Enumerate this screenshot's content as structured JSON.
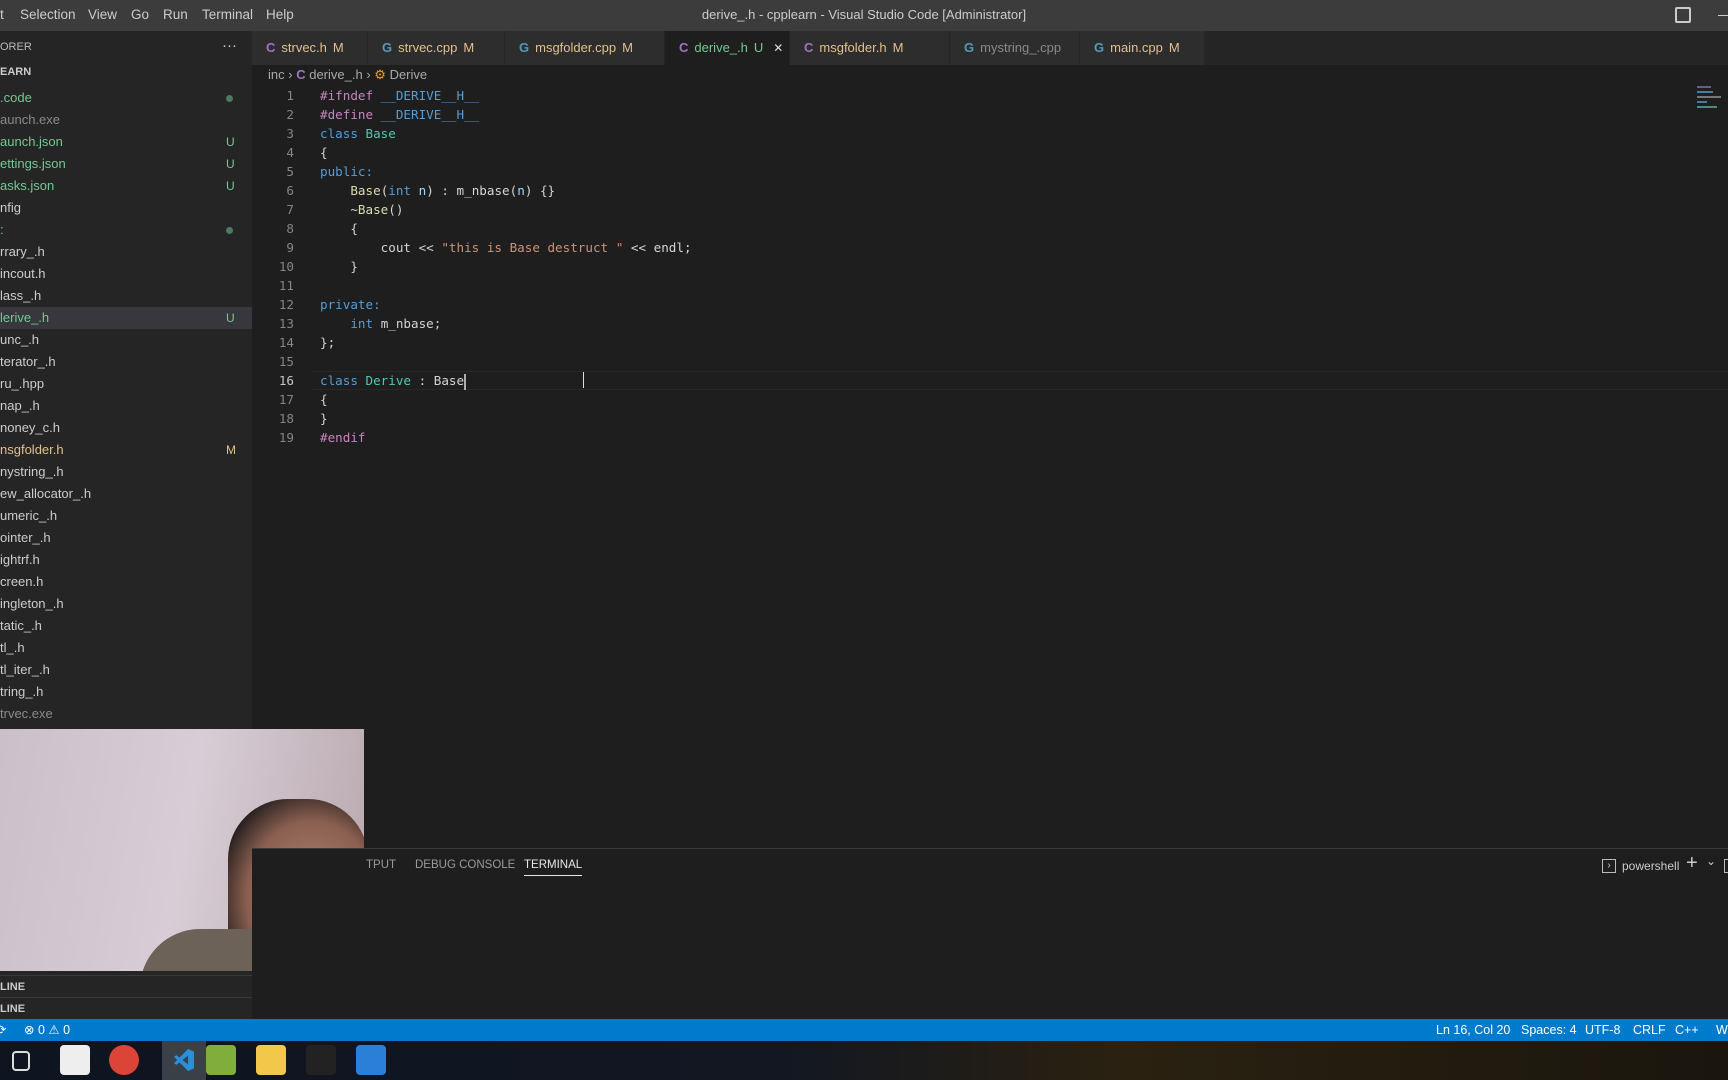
{
  "window": {
    "title": "derive_.h - cpplearn - Visual Studio Code [Administrator]"
  },
  "menu": [
    "t",
    "Selection",
    "View",
    "Go",
    "Run",
    "Terminal",
    "Help"
  ],
  "sidebar": {
    "header": "ORER",
    "more": "···",
    "root": "EARN",
    "items": [
      {
        "label": ".code",
        "c": "g",
        "dot": true
      },
      {
        "label": "aunch.exe",
        "c": "d"
      },
      {
        "label": "aunch.json",
        "c": "g",
        "badge": "U"
      },
      {
        "label": "ettings.json",
        "c": "g",
        "badge": "U"
      },
      {
        "label": "asks.json",
        "c": "g",
        "badge": "U"
      },
      {
        "label": "nfig",
        "c": "n"
      },
      {
        "label": ":",
        "c": "g",
        "dot": true
      },
      {
        "label": "rrary_.h",
        "c": "n"
      },
      {
        "label": "incout.h",
        "c": "n"
      },
      {
        "label": "lass_.h",
        "c": "n"
      },
      {
        "label": "lerive_.h",
        "c": "g",
        "badge": "U",
        "selected": true
      },
      {
        "label": "unc_.h",
        "c": "n"
      },
      {
        "label": "terator_.h",
        "c": "n"
      },
      {
        "label": "ru_.hpp",
        "c": "n"
      },
      {
        "label": "nap_.h",
        "c": "n"
      },
      {
        "label": "noney_c.h",
        "c": "n"
      },
      {
        "label": "nsgfolder.h",
        "c": "m",
        "badge": "M"
      },
      {
        "label": "nystring_.h",
        "c": "n"
      },
      {
        "label": "ew_allocator_.h",
        "c": "n"
      },
      {
        "label": "umeric_.h",
        "c": "n"
      },
      {
        "label": "ointer_.h",
        "c": "n"
      },
      {
        "label": "ightrf.h",
        "c": "n"
      },
      {
        "label": "creen.h",
        "c": "n"
      },
      {
        "label": "ingleton_.h",
        "c": "n"
      },
      {
        "label": "tatic_.h",
        "c": "n"
      },
      {
        "label": "tl_.h",
        "c": "n"
      },
      {
        "label": "tl_iter_.h",
        "c": "n"
      },
      {
        "label": "tring_.h",
        "c": "n"
      },
      {
        "label": "trvec.exe",
        "c": "d"
      }
    ],
    "outline": "LINE",
    "timeline": "LINE"
  },
  "tabs": [
    {
      "label": "strvec.h",
      "status": "M",
      "icon": "c-file-icon",
      "c": "m"
    },
    {
      "label": "strvec.cpp",
      "status": "M",
      "icon": "cpp-file-icon",
      "c": "m"
    },
    {
      "label": "msgfolder.cpp",
      "status": "M",
      "icon": "cpp-file-icon",
      "c": "m"
    },
    {
      "label": "derive_.h",
      "status": "U",
      "icon": "c-file-icon",
      "c": "g",
      "active": true
    },
    {
      "label": "msgfolder.h",
      "status": "M",
      "icon": "c-file-icon",
      "c": "m"
    },
    {
      "label": "mystring_.cpp",
      "status": "",
      "icon": "cpp-file-icon",
      "c": "d"
    },
    {
      "label": "main.cpp",
      "status": "M",
      "icon": "cpp-file-icon",
      "c": "m"
    }
  ],
  "breadcrumb": {
    "folder": "inc",
    "file": "derive_.h",
    "symbol": "Derive"
  },
  "editor": {
    "current_line": 16,
    "lines": [
      [
        [
          "#ifndef ",
          "pp"
        ],
        [
          "__DERIVE__H__",
          "mac"
        ]
      ],
      [
        [
          "#define ",
          "pp"
        ],
        [
          "__DERIVE__H__",
          "mac"
        ]
      ],
      [
        [
          "class ",
          "kw"
        ],
        [
          "Base",
          "ty"
        ]
      ],
      [
        [
          "{",
          "pl"
        ]
      ],
      [
        [
          "public:",
          "kw"
        ]
      ],
      [
        [
          "    ",
          "pl"
        ],
        [
          "Base",
          "fn"
        ],
        [
          "(",
          "pl"
        ],
        [
          "int ",
          "kw"
        ],
        [
          "n",
          "var"
        ],
        [
          ") : m_nbase(",
          "pl"
        ],
        [
          "n",
          "var"
        ],
        [
          ") {}",
          "pl"
        ]
      ],
      [
        [
          "    ~",
          "pl"
        ],
        [
          "Base",
          "fn"
        ],
        [
          "()",
          "pl"
        ]
      ],
      [
        [
          "    {",
          "pl"
        ]
      ],
      [
        [
          "        cout << ",
          "pl"
        ],
        [
          "\"this is Base destruct \"",
          "str"
        ],
        [
          " << endl;",
          "pl"
        ]
      ],
      [
        [
          "    }",
          "pl"
        ]
      ],
      [],
      [
        [
          "private:",
          "kw"
        ]
      ],
      [
        [
          "    ",
          "pl"
        ],
        [
          "int ",
          "kw"
        ],
        [
          "m_nbase;",
          "pl"
        ]
      ],
      [
        [
          "};",
          "pl"
        ]
      ],
      [],
      [
        [
          "class ",
          "kw"
        ],
        [
          "Derive",
          "ty"
        ],
        [
          " : ",
          "pl"
        ],
        [
          "Base",
          "pl"
        ]
      ],
      [
        [
          "{",
          "pl"
        ]
      ],
      [
        [
          "}",
          "pl"
        ]
      ],
      [
        [
          "#endif",
          "pp"
        ]
      ]
    ]
  },
  "panel": {
    "tabs": [
      "TPUT",
      "DEBUG CONSOLE",
      "TERMINAL"
    ],
    "active_tab": "TERMINAL",
    "terminal_name": "powershell",
    "add": "+",
    "chevron": "⌄"
  },
  "status": {
    "errors": "0",
    "warnings": "0",
    "position": "Ln 16, Col 20",
    "spaces": "Spaces: 4",
    "encoding": "UTF-8",
    "eol": "CRLF",
    "language": "C++",
    "extra": "Wi"
  },
  "taskbar": [
    "task-view-icon",
    "store-icon",
    "chrome-icon",
    "vscode-icon",
    "notepad-icon",
    "file-explorer-icon",
    "camera-icon",
    "photos-icon"
  ],
  "colors": {
    "accent": "#007acc",
    "modified": "#e2c08d",
    "untracked": "#73c991"
  }
}
